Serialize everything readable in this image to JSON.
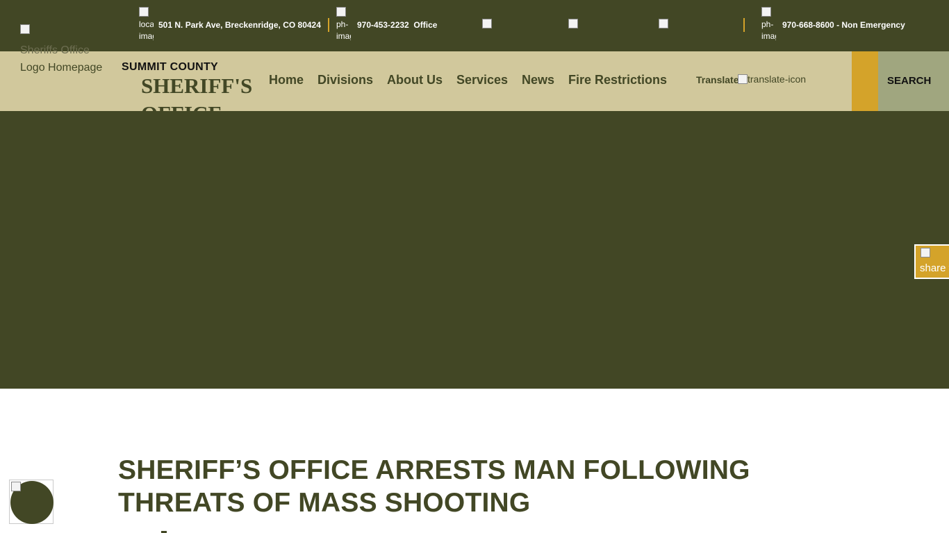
{
  "topbar": {
    "logo_icon": "broken-image-icon",
    "location_icon_alt": "location image",
    "address": "501 N. Park Ave, Breckenridge, CO 80424",
    "phone_icon_alt": "ph-image",
    "office_phone": "970-453-2232",
    "office_label": "Office",
    "social_icons": [
      "facebook-icon",
      "twitter-icon",
      "instagram-icon"
    ],
    "nonemergency_icon_alt": "ph-image",
    "nonemergency": "970-668-8600 - Non Emergency",
    "accent": "#d4a32a",
    "background": "#424725"
  },
  "navbar": {
    "logo_alt_line1": "Sheriffs Office",
    "logo_alt_line2": "Logo Homepage",
    "brand_top": "SUMMIT COUNTY",
    "brand_main": "SHERIFF'S OFFICE",
    "items": [
      {
        "label": "Home"
      },
      {
        "label": "Divisions"
      },
      {
        "label": "About Us"
      },
      {
        "label": "Services"
      },
      {
        "label": "News"
      },
      {
        "label": "Fire Restrictions"
      }
    ],
    "translate_label": "Translate",
    "translate_icon_alt": "translate-icon",
    "search_label": "SEARCH",
    "background": "#d1c89c"
  },
  "share": {
    "alt": "share widget"
  },
  "article": {
    "headline_line1": "SHERIFF’S OFFICE ARRESTS MAN FOLLOWING",
    "headline_line2": "THREATS OF MASS SHOOTING"
  },
  "accessibility": {
    "icon": "accessibility-icon"
  }
}
